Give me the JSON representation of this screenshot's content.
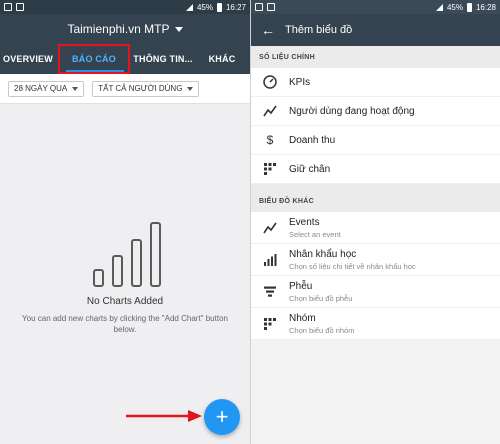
{
  "status": {
    "battery_left": "45%",
    "time_left": "16:27",
    "battery_right": "45%",
    "time_right": "16:28"
  },
  "left": {
    "title": "Taimienphi.vn MTP",
    "tabs": [
      "OVERVIEW",
      "BÁO CÁO",
      "THÔNG TIN...",
      "KHÁC"
    ],
    "filters": [
      "28 NGÀY QUA",
      "TẤT CẢ NGƯỜI DÙNG"
    ],
    "empty_title": "No Charts Added",
    "empty_desc": "You can add new charts by clicking the \"Add Chart\" button below.",
    "fab_label": "+"
  },
  "right": {
    "title": "Thêm biểu đồ",
    "back_icon": "←",
    "section1": "SỐ LIỆU CHÍNH",
    "main_items": [
      {
        "label": "KPIs",
        "icon": "speedometer-icon"
      },
      {
        "label": "Người dùng đang hoạt động",
        "icon": "trend-line-icon"
      },
      {
        "label": "Doanh thu",
        "icon": "dollar-icon"
      },
      {
        "label": "Giữ chân",
        "icon": "grid-icon"
      }
    ],
    "section2": "BIỂU ĐỒ KHÁC",
    "other_items": [
      {
        "label": "Events",
        "sub": "Select an event",
        "icon": "trend-line-icon"
      },
      {
        "label": "Nhân khẩu học",
        "sub": "Chọn số liệu chi tiết về nhân khẩu học",
        "icon": "bars-icon"
      },
      {
        "label": "Phễu",
        "sub": "Chọn biểu đồ phễu",
        "icon": "funnel-icon"
      },
      {
        "label": "Nhóm",
        "sub": "Chọn biểu đồ nhóm",
        "icon": "grid-icon"
      }
    ]
  },
  "colors": {
    "appbar": "#34434f",
    "accent": "#2196f3",
    "highlight": "#e3141b"
  }
}
